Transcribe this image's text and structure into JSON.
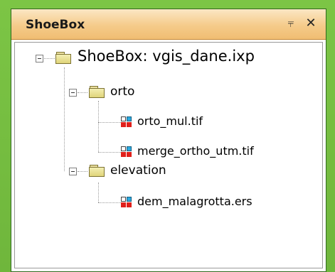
{
  "panel": {
    "title": "ShoeBox",
    "pin_glyph": "⫧",
    "close_glyph": "✕"
  },
  "tree": {
    "root": {
      "label": "ShoeBox: vgis_dane.ixp",
      "icon": "folder-icon"
    },
    "groups": [
      {
        "label": "orto",
        "icon": "folder-icon",
        "files": [
          {
            "label": "orto_mul.tif",
            "icon": "raster-file-icon"
          },
          {
            "label": "merge_ortho_utm.tif",
            "icon": "raster-file-icon"
          }
        ]
      },
      {
        "label": "elevation",
        "icon": "folder-icon",
        "files": [
          {
            "label": "dem_malagrotta.ers",
            "icon": "raster-file-icon"
          }
        ]
      }
    ]
  },
  "colors": {
    "background": "#79c043",
    "titlebar": "#f5cb8a",
    "folder": "#e0d57a",
    "file_icon_red": "#e0201b",
    "file_icon_cyan": "#2aa9e0"
  }
}
